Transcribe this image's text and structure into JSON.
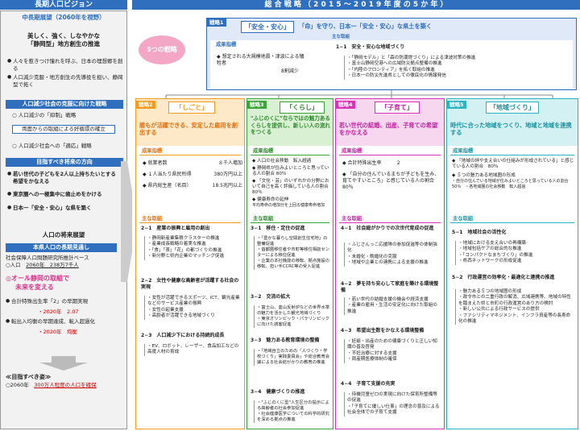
{
  "left": {
    "header": "長期人口ビジョン",
    "sub_header": "中長期展望（2060年を視野）",
    "vision_title_1": "美しく、強く、しなやかな",
    "vision_title_2": "「静岡型」地方創生の推進",
    "bullets": [
      "人々を惹きつけ憧れを呼ぶ、日本の理想郷を創る",
      "人口減少克服・地方創生の先導役を担い、静岡型で拓く"
    ],
    "challenge_bar": "人口減少社会の克服に向けた戦略",
    "challenge_items": [
      "人口減少の「抑制」戦略",
      "人口減少社会への「適応」戦略"
    ],
    "mid_box": "両面からの取組による好循環の確立",
    "target_bar": "目指すべき将来の方向",
    "target_items": [
      "若い世代の子どもを2人以上持ちたいとする希望をかなえる",
      "東京圏への一極集中に歯止めをかける",
      "日本一「安全・安心」な県を築く"
    ],
    "future_header": "人口の将来展望",
    "basic_bar": "本県人口の長期見通し",
    "basic_source": "社会保障人口問題研究所推計ベース",
    "basic_row_label": "○人口",
    "basic_row_value": "2060年　238万7千人",
    "all_title_1": "◎オール静岡の取組で",
    "all_title_2": "未来を変える",
    "all_bullets": [
      "合計特殊出生率「2」の早期実現",
      "転出入均衡の早期達成、転入超過化"
    ],
    "all_values": [
      "・2020年　2.07",
      "・2020年　均衡"
    ],
    "goal_title": "≪目指すべき姿≫",
    "goal_text_a": "○2060年　",
    "goal_text_b": "300万人程度の人口を確保"
  },
  "right": {
    "header": "総 合 戦 略 （ 2 0 1 5 ～ 2 0 1 9 年 度 の 5 か 年 ）",
    "five_label": "5つの戦略",
    "s1": {
      "tab": "戦略1",
      "keyword": "「安全・安心」",
      "lead": "「命」を守り、日本一「安全・安心」な県土を築く",
      "kpi_head": "成果指標",
      "kpi_items": [
        "想定される大規模地震・津波による犠牲者"
      ],
      "kpi_value": "8割減少",
      "main_head": "主な取組",
      "main_num": "1−1　安全・安心な地域づくり",
      "main_items": [
        "「静岡モデル」と「森の防潮堤づくり」による津波対策の推進",
        "富士山静岡空港への広域防災拠点整備の推進",
        "「内陸のフロンティア」を拓く取組の推進",
        "日本一の防災先進県としての徹底化の情報発信"
      ]
    },
    "s2": {
      "tab": "戦略2",
      "keyword": "「しごと」",
      "lead": "誰もが活躍できる、安定した雇用を創出する",
      "kpi_head": "成果指標",
      "kpis": [
        [
          "就業者数",
          "８千人増加"
        ],
        [
          "１人当たり県民所得",
          "380万円以上"
        ],
        [
          "県内総生産（名目）",
          "18.5兆円以上"
        ]
      ],
      "main_head": "主な取組",
      "m1": "2−1　産業の振興と雇用の創出",
      "m1_items": [
        "静岡新産業集積クラスターの推進",
        "産業成長戦略の着実な推進",
        "「食」「茶」「花」の都づくりの推進",
        "新分野と県内企業のマッチング促進"
      ],
      "m2": "2−2　女性や健康な高齢者が活躍する社会の実現",
      "m2_items": [
        "女性が活躍できるスポーツ、ICT、観光産業などのサービス産業の振興",
        "女性の起業支援",
        "高齢者が活躍できる地域づくり"
      ],
      "m3": "2−3　人口減少下における持続的成長",
      "m3_items": [
        "EV、ロボット、レーザー、食品加工などの高度人材の育成"
      ]
    },
    "s3": {
      "tab": "戦略3",
      "keyword": "「くらし」",
      "lead": "\"ふじのくに\"ならではの魅力あるくらしを提供し、新しい人の流れをつくる",
      "kpi_head": "成果指標",
      "kpis": [
        [
          "人口の社会移動",
          "転入超過"
        ],
        [
          "静岡県が住みよいところと思っている人の割合",
          "80％"
        ],
        [
          "「文化・芸」のいずれかの分野において自己を高く評価している人の割合",
          "80％"
        ],
        [
          "健康寿命の延伸",
          "平均寿命の増加分を上回る健康寿命増加"
        ]
      ],
      "main_head": "主な取組",
      "m1": "3−1　移住・定住の促進",
      "m1_items": [
        "「豊かな暮らし空間創生住宅地」の整備促進",
        "首都圏移住者や市町等移住相談センターによる移住促進",
        "企業の本社機能の移転、拠点施設の移転、担い手CCRC等の受入促進"
      ],
      "m2": "3−2　交流の拡大",
      "m2_items": [
        "富士山、韮山反射炉などの世界水準の魅力を活かした観光地域づくり",
        "東京オリンピック・パラリンピックに向けた誘客促進"
      ],
      "m3": "3−3　魅力ある教育環境の整備",
      "m3_items": [
        "「地域自立のための「人づくり・学校づくり」実践委員会」や総合教育会議による社会総がかりの教育の推進"
      ],
      "m4": "3−4　健康づくりの推進",
      "m4_items": [
        "\"ふじのくに型\"人生区分の提示による高齢者の社会参加促進",
        "社会健康医学についての科学的研究を深める拠点の推進"
      ]
    },
    "s4": {
      "tab": "戦略4",
      "keyword": "「子育て」",
      "lead": "若い世代の結婚、出産、子育ての希望をかなえる",
      "kpi_head": "成果指標",
      "kpis": [
        [
          "合計特殊出生率",
          "２"
        ],
        [
          "「自分の住んでいるまちが子どもを生み、育てやすいところ」と感じている人の割合",
          "80％"
        ]
      ],
      "main_head": "主な取組",
      "m1": "4−1　社会総がかりでの次世代育成の促進",
      "m1_items": [
        "ふじさんっこ応援隊の参加促進等の体制強化",
        "未婚化・晩婚化の克服",
        "地域や企業との連携による支援の推進"
      ],
      "m2": "4−2　夢を持ち安心して家庭を築ける環境整備",
      "m2_items": [
        "若い世代の結婚支援の機会や経済支援",
        "産業の雇用・生活の安定化に向けた取組の推進"
      ],
      "m3": "4−3　希望出生数をかなえる環境整備",
      "m3_items": [
        "妊娠・出産のための健康づくりと正しい知識の普及啓発",
        "不妊治療に対する支援",
        "周産期医療体制の確保"
      ],
      "m4": "4−4　子育て支援の充実",
      "m4_items": [
        "待機児童ゼロの実現に向けた保育所整備等の促進",
        "「子育てに優しい仕事」の理念の普及による社会全体での子育て支援"
      ]
    },
    "s5": {
      "tab": "戦略5",
      "keyword": "「地域づくり」",
      "lead": "時代に合った地域をつくり、地域と地域を連携する",
      "kpi_head": "成果指標",
      "kpis": [
        [
          "「地域の絆や支え合いの仕組みが形成されている」と感じている人の割合",
          "80％"
        ],
        [
          "５つの魅力ある地域圏の形成",
          "・自分の住んでいる地域が住みよいところと思っている人の割合　　50％　・各地域圏の社会移動　転入超過"
        ]
      ],
      "main_head": "主な取組",
      "m1": "5−1　地域社会の活性化",
      "m1_items": [
        "地域における支え合いの再構築",
        "地域包括ケアの総合的な推進",
        "「コンパクトなまちづくり」の推進",
        "県西ネットワークの形成促進"
      ],
      "m2": "5−2　行政運営の効率化・最適化と連携の推進",
      "m2_items": [
        "魅力ある５つの地域圏の形成",
        "政令市との二重行政の解消、広域連携等、地域の特性を踏まえた県と市町の行政運営のあり方の検討",
        "新しい公共による行政サービスの提供",
        "ファシリティマネジメント、インフラ資産等の長寿命化の推進"
      ]
    }
  }
}
